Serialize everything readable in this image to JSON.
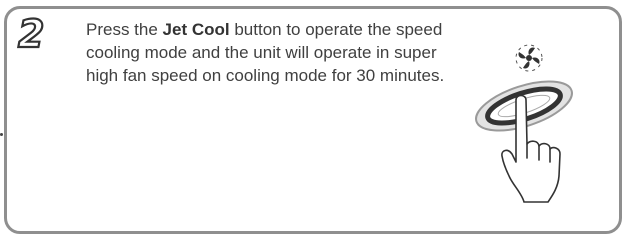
{
  "step": {
    "number": "2",
    "text_before": "Press the ",
    "button_name": "Jet Cool",
    "text_after": " button to operate the speed cooling mode and the unit will operate in super high fan speed on cooling mode for 30 minutes."
  },
  "illustration": {
    "icons": [
      "fan-swirl-icon",
      "oval-button-icon",
      "pointing-hand-icon"
    ]
  }
}
